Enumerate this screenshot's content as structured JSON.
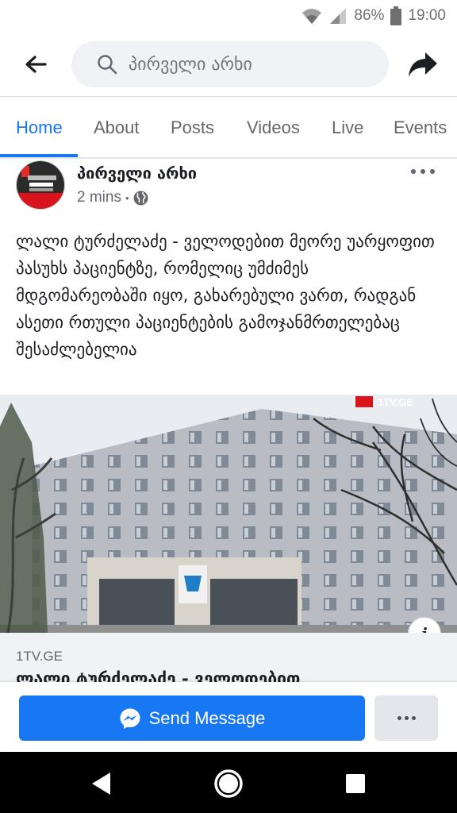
{
  "status": {
    "battery": "86%",
    "time": "19:00"
  },
  "search": {
    "placeholder": "პირველი არხი"
  },
  "tabs": [
    {
      "label": "Home",
      "active": true
    },
    {
      "label": "About"
    },
    {
      "label": "Posts"
    },
    {
      "label": "Videos"
    },
    {
      "label": "Live"
    },
    {
      "label": "Events"
    }
  ],
  "post": {
    "page_name": "პირველი არხი",
    "time": "2 mins",
    "separator": "•",
    "text": "ლალი ტურძელაძე - ველოდებით მეორე უარყოფით პასუხს პაციენტზე, რომელიც უმძიმეს მდგომარეობაში იყო, გახარებული ვართ, რადგან ასეთი რთული პაციენტების გამოჯანმრთელებაც შესაძლებელია",
    "image_watermark": "1TV.GE",
    "link_domain": "1TV.GE",
    "link_title": "ლალი ტურძელაძე - ველოდებით"
  },
  "actions": {
    "send_message": "Send Message"
  },
  "colors": {
    "accent": "#1877f2",
    "nav_bar": "#000000"
  }
}
